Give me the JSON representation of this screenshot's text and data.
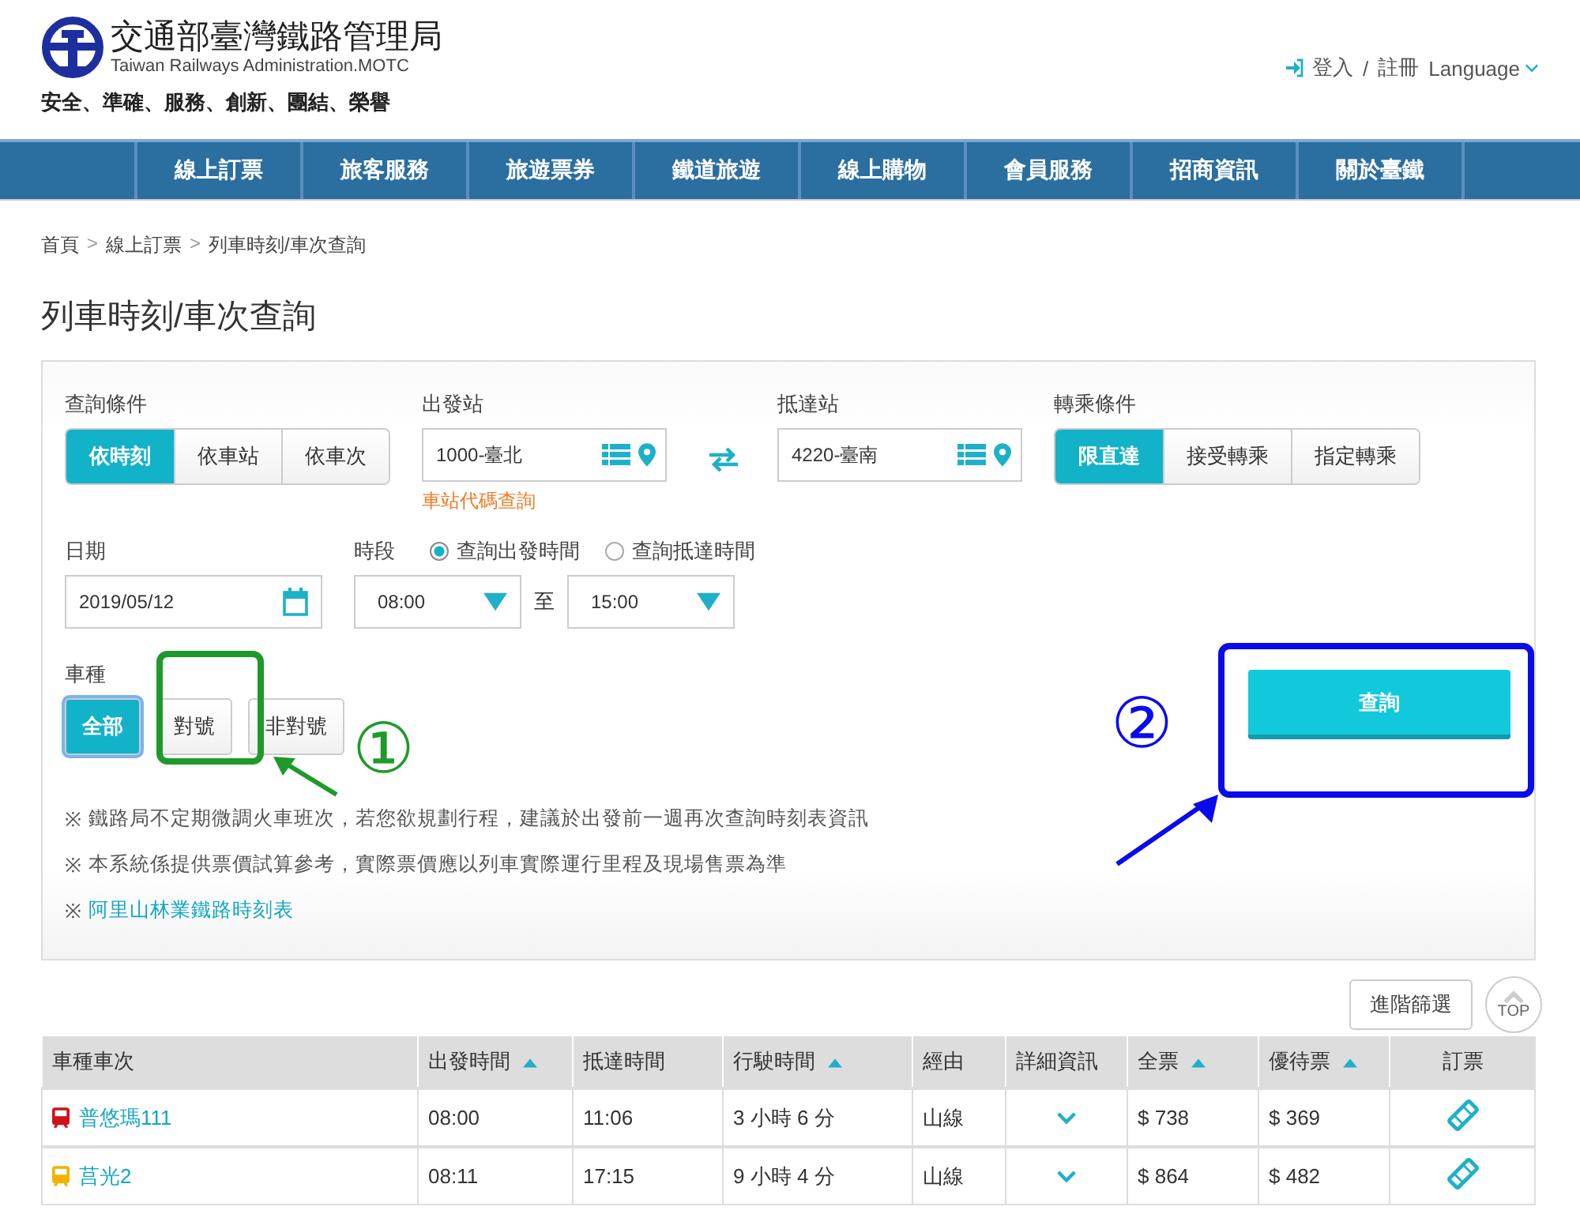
{
  "header": {
    "org_name": "交通部臺灣鐵路管理局",
    "org_name_en": "Taiwan Railways Administration.MOTC",
    "slogan": "安全、準確、服務、創新、團結、榮譽",
    "login": "登入",
    "separator": "/",
    "register": "註冊",
    "language": "Language"
  },
  "nav": [
    "線上訂票",
    "旅客服務",
    "旅遊票券",
    "鐵道旅遊",
    "線上購物",
    "會員服務",
    "招商資訊",
    "關於臺鐵"
  ],
  "breadcrumb": [
    {
      "label": "首頁",
      "separator": ">"
    },
    {
      "label": "線上訂票",
      "separator": ">"
    },
    {
      "label": "列車時刻/車次查詢"
    }
  ],
  "page_title": "列車時刻/車次查詢",
  "form": {
    "query_mode": {
      "label": "查詢條件",
      "options": [
        {
          "label": "依時刻",
          "selected": true
        },
        {
          "label": "依車站",
          "selected": false
        },
        {
          "label": "依車次",
          "selected": false
        }
      ]
    },
    "departure": {
      "label": "出發站",
      "value": "1000-臺北",
      "link": "車站代碼查詢"
    },
    "arrival": {
      "label": "抵達站",
      "value": "4220-臺南"
    },
    "transfer": {
      "label": "轉乘條件",
      "options": [
        {
          "label": "限直達",
          "selected": true
        },
        {
          "label": "接受轉乘",
          "selected": false
        },
        {
          "label": "指定轉乘",
          "selected": false
        }
      ]
    },
    "date": {
      "label": "日期",
      "value": "2019/05/12"
    },
    "period": {
      "label": "時段",
      "radios": [
        {
          "label": "查詢出發時間",
          "selected": true
        },
        {
          "label": "查詢抵達時間",
          "selected": false
        }
      ],
      "from": "08:00",
      "to_label": "至",
      "to": "15:00"
    },
    "car_type": {
      "label": "車種",
      "options": [
        {
          "label": "全部",
          "selected": true
        },
        {
          "label": "對號",
          "selected": false
        },
        {
          "label": "非對號",
          "selected": false
        }
      ]
    },
    "search_button": "查詢",
    "notes": [
      {
        "mark": "※",
        "text": "鐵路局不定期微調火車班次，若您欲規劃行程，建議於出發前一週再次查詢時刻表資訊",
        "kind": "text"
      },
      {
        "mark": "※",
        "text": "本系統係提供票價試算參考，實際票價應以列車實際運行里程及現場售票為準",
        "kind": "text"
      },
      {
        "mark": "※",
        "text": "阿里山林業鐵路時刻表",
        "kind": "link"
      }
    ]
  },
  "annotations": [
    {
      "label": "①",
      "color": "#1f9a2a"
    },
    {
      "label": "②",
      "color": "#0a0af0"
    }
  ],
  "advanced_filter": "進階篩選",
  "back_to_top": "TOP",
  "table": {
    "columns": [
      {
        "label": "車種車次",
        "sortable": false
      },
      {
        "label": "出發時間",
        "sortable": true
      },
      {
        "label": "抵達時間",
        "sortable": false
      },
      {
        "label": "行駛時間",
        "sortable": true
      },
      {
        "label": "經由",
        "sortable": false
      },
      {
        "label": "詳細資訊",
        "sortable": false
      },
      {
        "label": "全票",
        "sortable": true
      },
      {
        "label": "優待票",
        "sortable": true
      },
      {
        "label": "訂票",
        "sortable": false
      }
    ],
    "rows": [
      {
        "train": "普悠瑪111",
        "color": "#d0121b",
        "depart": "08:00",
        "arrive": "11:06",
        "duration": "3 小時 6 分",
        "route": "山線",
        "fare_full": "$ 738",
        "fare_discount": "$ 369"
      },
      {
        "train": "莒光2",
        "color": "#f0b400",
        "depart": "08:11",
        "arrive": "17:15",
        "duration": "9 小時 4 分",
        "route": "山線",
        "fare_full": "$ 864",
        "fare_discount": "$ 482"
      }
    ]
  }
}
